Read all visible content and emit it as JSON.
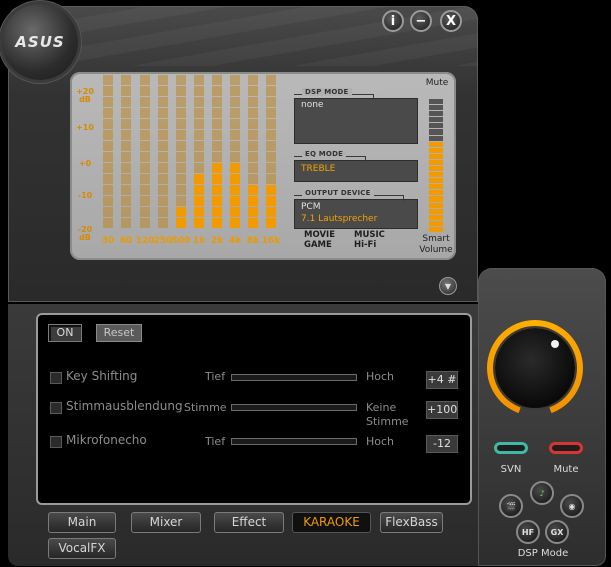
{
  "window": {
    "logo": "ASUS",
    "buttons": {
      "info": "i",
      "minimize": "−",
      "close": "X"
    }
  },
  "display": {
    "db_labels": [
      "+20 dB",
      "+10",
      "+0",
      "-10",
      "-20 dB"
    ],
    "eq_bands": [
      {
        "freq": "30",
        "level": 0
      },
      {
        "freq": "60",
        "level": 0
      },
      {
        "freq": "120",
        "level": 0
      },
      {
        "freq": "250",
        "level": 0
      },
      {
        "freq": "500",
        "level": 4
      },
      {
        "freq": "1k",
        "level": 10
      },
      {
        "freq": "2k",
        "level": 12
      },
      {
        "freq": "4k",
        "level": 12
      },
      {
        "freq": "8k",
        "level": 8
      },
      {
        "freq": "16k",
        "level": 8
      }
    ],
    "dsp_mode_title": "DSP MODE",
    "dsp_mode_value": "none",
    "eq_mode_title": "EQ MODE",
    "eq_mode_value": "TREBLE",
    "output_device_title": "OUTPUT DEVICE",
    "output_device_line1": "PCM",
    "output_device_line2": "7.1 Lautsprecher",
    "modes": {
      "movie": "MOVIE",
      "game": "GAME",
      "music": "MUSIC",
      "hifi": "Hi-Fi"
    },
    "mute_label": "Mute",
    "smart_volume_label_1": "Smart",
    "smart_volume_label_2": "Volume",
    "volume_level_fraction": 0.67
  },
  "karaoke": {
    "on_label": "ON",
    "reset_label": "Reset",
    "effects": [
      {
        "label": "Key Shifting",
        "left": "Tief",
        "right": "Hoch",
        "right2": "",
        "value": "+4 #"
      },
      {
        "label": "Stimmausblendung",
        "left": "Stimme",
        "right": "Keine",
        "right2": "Stimme",
        "value": "+100"
      },
      {
        "label": "Mikrofonecho",
        "left": "Tief",
        "right": "Hoch",
        "right2": "",
        "value": "-12"
      }
    ]
  },
  "tabs": [
    "Main",
    "Mixer",
    "Effect",
    "KARAOKE",
    "FlexBass",
    "VocalFX"
  ],
  "active_tab": "KARAOKE",
  "side": {
    "svn_label": "SVN",
    "mute_label": "Mute",
    "dsp_mode_label": "DSP Mode",
    "dsp_buttons": {
      "hf": "HF",
      "gx": "GX"
    },
    "colors": {
      "accent": "#f29a00",
      "svn": "#3fb8a8",
      "mute": "#d83434"
    }
  }
}
